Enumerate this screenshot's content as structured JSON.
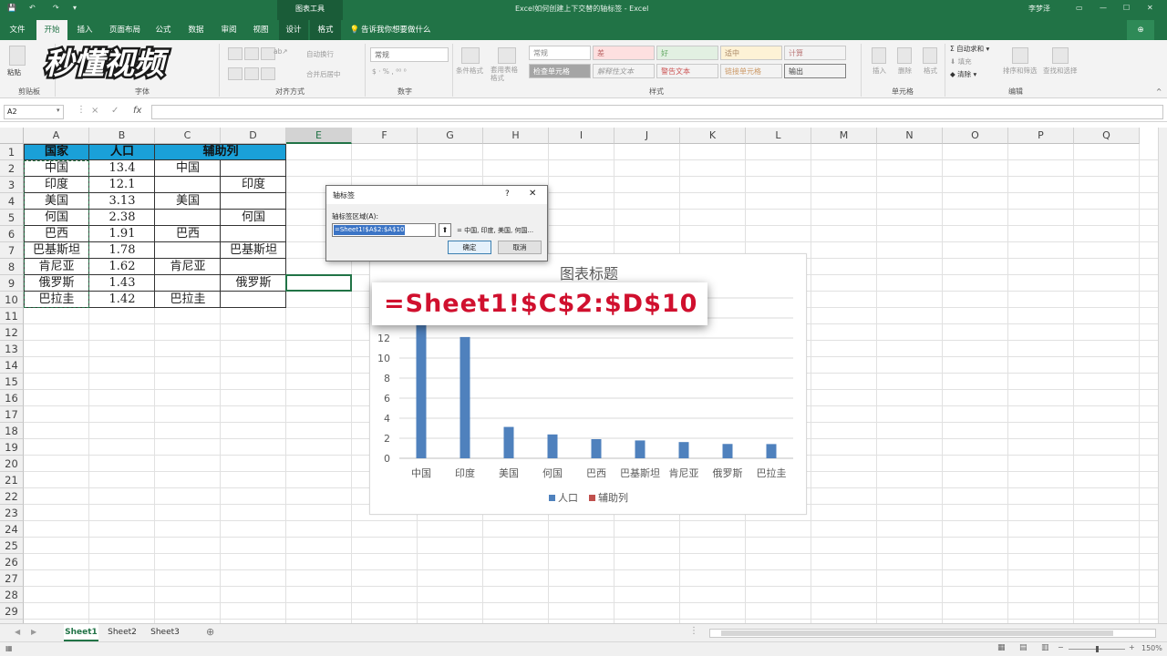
{
  "titlebar": {
    "context_tab": "图表工具",
    "doc_title": "Excel如何创建上下交替的轴标签 - Excel",
    "user": "李梦泽",
    "quick_access": [
      "保存",
      "撤销",
      "恢复"
    ]
  },
  "ribbon_tabs": {
    "file": "文件",
    "home": "开始",
    "insert": "插入",
    "page_layout": "页面布局",
    "formulas": "公式",
    "data": "数据",
    "review": "审阅",
    "view": "视图",
    "design": "设计",
    "format": "格式",
    "tell_me": "告诉我你想要做什么"
  },
  "ribbon": {
    "paste": "粘贴",
    "clipboard": "剪贴板",
    "font": "字体",
    "alignment": "对齐方式",
    "number": "数字",
    "styles": "样式",
    "cells": "单元格",
    "editing": "编辑",
    "wrap_text": "自动换行",
    "merge_center": "合并后居中",
    "number_format": "常规",
    "conditional_format": "条件格式",
    "table_format": "套用表格格式",
    "styles_list": [
      "常规",
      "差",
      "好",
      "适中",
      "计算",
      "检查单元格",
      "解释性文本",
      "警告文本",
      "链接单元格",
      "输出"
    ],
    "insert": "插入",
    "delete": "删除",
    "format": "格式",
    "autosum": "自动求和",
    "fill": "填充",
    "clear": "清除",
    "sort_filter": "排序和筛选",
    "find_select": "查找和选择"
  },
  "logo_text": "秒懂视频",
  "formula_bar": {
    "name_box": "A2",
    "fx": "fx",
    "cancel": "×",
    "enter": "✓",
    "content": ""
  },
  "columns": [
    "A",
    "B",
    "C",
    "D",
    "E",
    "F",
    "G",
    "H",
    "I",
    "J",
    "K",
    "L",
    "M",
    "N",
    "O",
    "P",
    "Q"
  ],
  "rows": [
    "1",
    "2",
    "3",
    "4",
    "5",
    "6",
    "7",
    "8",
    "9",
    "10",
    "11",
    "12",
    "13",
    "14",
    "15",
    "16",
    "17",
    "18",
    "19",
    "20",
    "21",
    "22",
    "23",
    "24",
    "25",
    "26",
    "27",
    "28",
    "29",
    "30"
  ],
  "table": {
    "headers": [
      "国家",
      "人口",
      "辅助列"
    ],
    "rows": [
      {
        "country": "中国",
        "pop": "13.4",
        "c": "中国",
        "d": ""
      },
      {
        "country": "印度",
        "pop": "12.1",
        "c": "",
        "d": "印度"
      },
      {
        "country": "美国",
        "pop": "3.13",
        "c": "美国",
        "d": ""
      },
      {
        "country": "何国",
        "pop": "2.38",
        "c": "",
        "d": "何国"
      },
      {
        "country": "巴西",
        "pop": "1.91",
        "c": "巴西",
        "d": ""
      },
      {
        "country": "巴基斯坦",
        "pop": "1.78",
        "c": "",
        "d": "巴基斯坦"
      },
      {
        "country": "肯尼亚",
        "pop": "1.62",
        "c": "肯尼亚",
        "d": ""
      },
      {
        "country": "俄罗斯",
        "pop": "1.43",
        "c": "",
        "d": "俄罗斯"
      },
      {
        "country": "巴拉圭",
        "pop": "1.42",
        "c": "巴拉圭",
        "d": ""
      }
    ]
  },
  "chart_data": {
    "type": "bar",
    "title": "图表标题",
    "categories": [
      "中国",
      "印度",
      "美国",
      "何国",
      "巴西",
      "巴基斯坦",
      "肯尼亚",
      "俄罗斯",
      "巴拉圭"
    ],
    "series": [
      {
        "name": "人口",
        "values": [
          13.4,
          12.1,
          3.13,
          2.38,
          1.91,
          1.78,
          1.62,
          1.43,
          1.42
        ],
        "color": "#4f81bd"
      },
      {
        "name": "辅助列",
        "values": [],
        "color": "#c0504d"
      }
    ],
    "y_ticks": [
      "0",
      "2",
      "4",
      "6",
      "8",
      "10",
      "12"
    ],
    "ylim": [
      0,
      16
    ],
    "grid": true,
    "legend": "bottom"
  },
  "dialog": {
    "title": "轴标签",
    "help": "?",
    "close": "✕",
    "range_label": "轴标签区域(A):",
    "range_value": "=Sheet1!$A$2:$A$10",
    "preview": "= 中国, 印度, 美国, 何国...",
    "ok": "确定",
    "cancel": "取消"
  },
  "overlay_formula": "=Sheet1!$C$2:$D$10",
  "sheet_tabs": [
    "Sheet1",
    "Sheet2",
    "Sheet3"
  ],
  "status": {
    "zoom": "150%"
  },
  "colors": {
    "excel_green": "#217346",
    "header_fill": "#1aa0d8",
    "bar": "#4f81bd",
    "overlay_text": "#d0102e"
  }
}
